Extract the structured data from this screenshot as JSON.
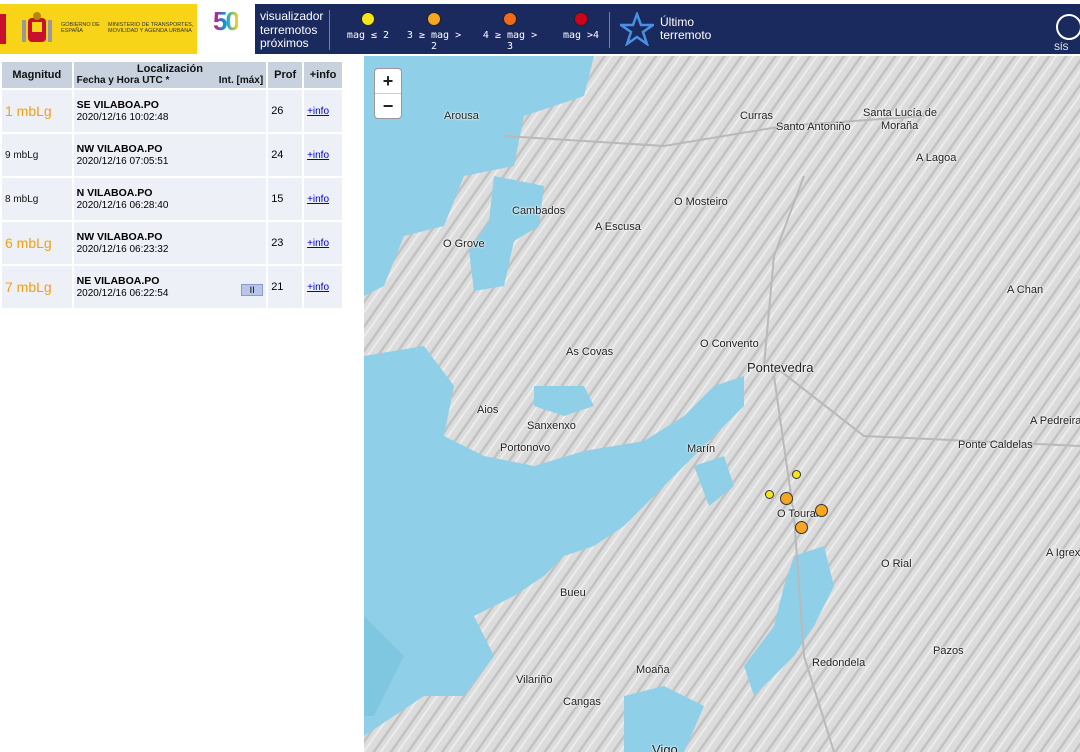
{
  "header": {
    "gov_line1": "GOBIERNO DE ESPAÑA",
    "gov_line2": "MINISTERIO DE TRANSPORTES, MOVILIDAD Y AGENDA URBANA",
    "anniversary_number": "50",
    "title": [
      "visualizador",
      "terremotos",
      "próximos"
    ],
    "legend": [
      {
        "label": "mag ≤ 2",
        "color": "#f5e51b"
      },
      {
        "label": "3 ≥ mag > 2",
        "color": "#f5a623"
      },
      {
        "label": "4 ≥ mag > 3",
        "color": "#ef6a1a"
      },
      {
        "label": "mag >4",
        "color": "#d0021b"
      }
    ],
    "latest_label": [
      "Último",
      "terremoto"
    ],
    "right_logo_text": "SÍS"
  },
  "table": {
    "headers": {
      "magnitude": "Magnitud",
      "location": "Localización",
      "datetime": "Fecha y Hora UTC *",
      "intensity": "Int. [máx]",
      "depth": "Prof",
      "info": "+info"
    },
    "rows": [
      {
        "magnitude": "1 mbLg",
        "mag_class": "mag-orange",
        "location": "SE VILABOA.PO",
        "datetime": "2020/12/16 10:02:48",
        "intensity": "",
        "depth": "26",
        "info": "+info"
      },
      {
        "magnitude": "9 mbLg",
        "mag_class": "mag-small",
        "location": "NW VILABOA.PO",
        "datetime": "2020/12/16 07:05:51",
        "intensity": "",
        "depth": "24",
        "info": "+info"
      },
      {
        "magnitude": "8 mbLg",
        "mag_class": "mag-small",
        "location": "N VILABOA.PO",
        "datetime": "2020/12/16 06:28:40",
        "intensity": "",
        "depth": "15",
        "info": "+info"
      },
      {
        "magnitude": "6 mbLg",
        "mag_class": "mag-orange",
        "location": "NW VILABOA.PO",
        "datetime": "2020/12/16 06:23:32",
        "intensity": "",
        "depth": "23",
        "info": "+info"
      },
      {
        "magnitude": "7 mbLg",
        "mag_class": "mag-orange",
        "location": "NE VILABOA.PO",
        "datetime": "2020/12/16 06:22:54",
        "intensity": "II",
        "depth": "21",
        "info": "+info"
      }
    ]
  },
  "map": {
    "zoom_in": "+",
    "zoom_out": "−",
    "places": {
      "arousa": "Arousa",
      "curras": "Curras",
      "santo_antonino": "Santo Antoniño",
      "santa_lucia": "Santa Lucía de",
      "morana": "Moraña",
      "a_lagoa": "A Lagoa",
      "cambados": "Cambados",
      "o_mosteiro": "O Mosteiro",
      "a_escusa": "A Escusa",
      "o_grove": "O Grove",
      "a_chan": "A Chan",
      "o_convento": "O Convento",
      "as_covas": "As Covas",
      "pontevedra": "Pontevedra",
      "aios": "Aios",
      "sanxenxo": "Sanxenxo",
      "a_pedreira": "A Pedreira",
      "portonovo": "Portonovo",
      "marin": "Marín",
      "ponte_caldelas": "Ponte Caldelas",
      "o_toural": "O Toural",
      "a_igrexa": "A Igrex",
      "o_rial": "O Rial",
      "bueu": "Bueu",
      "pazos": "Pazos",
      "moana": "Moaña",
      "redondela": "Redondela",
      "vilarino": "Vilariño",
      "cangas": "Cangas",
      "vigo": "Vigo"
    }
  }
}
